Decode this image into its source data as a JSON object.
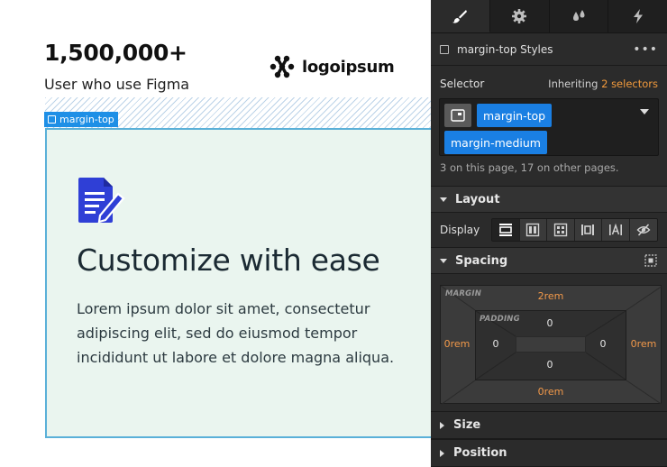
{
  "canvas": {
    "stat_number": "1,500,000+",
    "stat_caption": "User who use Figma",
    "logo_text": "logoipsum",
    "selected_tag": "margin-top",
    "card": {
      "title": "Customize with ease",
      "body": "Lorem ipsum dolor sit amet, consectetur adipiscing elit, sed do eiusmod tempor incididunt ut labore et dolore magna aliqua."
    }
  },
  "panel": {
    "tabs": [
      "paint-brush-icon",
      "gear-icon",
      "drops-icon",
      "lightning-icon"
    ],
    "styles_header": "margin-top Styles",
    "more": "•••",
    "selector_label": "Selector",
    "inheriting_text": "Inheriting",
    "inheriting_count": "2 selectors",
    "selectors": [
      "margin-top",
      "margin-medium"
    ],
    "usage": "3 on this page, 17 on other pages.",
    "sections": {
      "layout": "Layout",
      "spacing": "Spacing",
      "size": "Size",
      "position": "Position"
    },
    "display_label": "Display",
    "display_options": [
      "block",
      "flex",
      "grid",
      "inline-block",
      "inline",
      "none"
    ],
    "display_active": "block",
    "box_model": {
      "margin_label": "MARGIN",
      "padding_label": "PADDING",
      "margin_top": "2rem",
      "margin_right": "0rem",
      "margin_bottom": "0rem",
      "margin_left": "0rem",
      "padding_top": "0",
      "padding_right": "0",
      "padding_bottom": "0",
      "padding_left": "0"
    }
  },
  "colors": {
    "accent": "#1a7fe3",
    "highlight_orange": "#f2994a",
    "card_bg": "#eaf5ef",
    "icon_blue": "#2f3fd6"
  }
}
